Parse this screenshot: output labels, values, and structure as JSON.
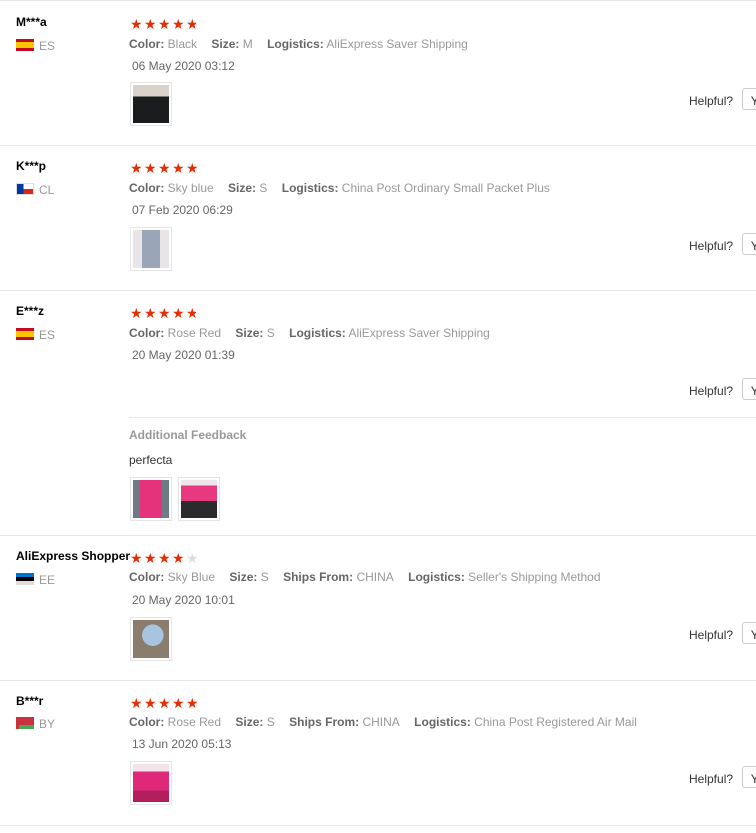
{
  "labels": {
    "color": "Color:",
    "size": "Size:",
    "logistics": "Logistics:",
    "ships_from": "Ships From:",
    "helpful": "Helpful?",
    "yes_button": "Yes",
    "additional_feedback": "Additional Feedback"
  },
  "reviews": [
    {
      "user": "M***a",
      "country": "ES",
      "rating": 4.5,
      "color": "Black",
      "size": "M",
      "logistics": "AliExpress Saver Shipping",
      "date": "06 May 2020 03:12"
    },
    {
      "user": "K***p",
      "country": "CL",
      "rating": 5,
      "color": "Sky blue",
      "size": "S",
      "logistics": "China Post Ordinary Small Packet Plus",
      "date": "07 Feb 2020 06:29"
    },
    {
      "user": "E***z",
      "country": "ES",
      "rating": 4.5,
      "color": "Rose Red",
      "size": "S",
      "logistics": "AliExpress Saver Shipping",
      "date": "20 May 2020 01:39",
      "additional_feedback": "perfecta"
    },
    {
      "user": "AliExpress Shopper",
      "country": "EE",
      "rating": 4,
      "color": "Sky Blue",
      "size": "S",
      "ships_from": "CHINA",
      "logistics": "Seller's Shipping Method",
      "date": "20 May 2020 10:01"
    },
    {
      "user": "B***r",
      "country": "BY",
      "rating": 5,
      "color": "Rose Red",
      "size": "S",
      "ships_from": "CHINA",
      "logistics": "China Post Registered Air Mail",
      "date": "13 Jun 2020 05:13"
    }
  ]
}
